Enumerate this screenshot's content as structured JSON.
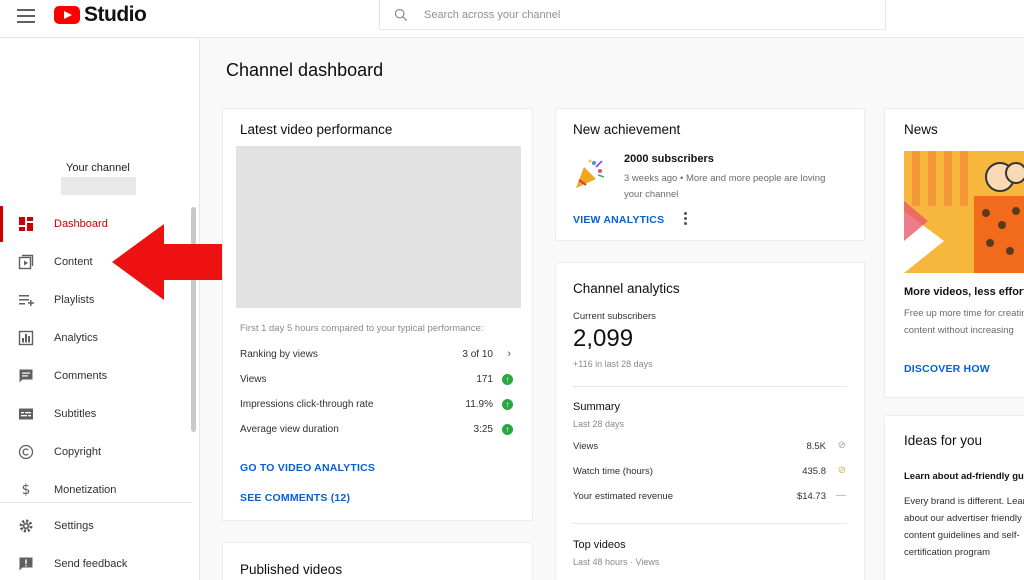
{
  "app": {
    "logo_text": "Studio"
  },
  "search": {
    "placeholder": "Search across your channel"
  },
  "sidebar": {
    "channel_label": "Your channel",
    "items": [
      {
        "label": "Dashboard",
        "icon": "dashboard-icon",
        "active": true
      },
      {
        "label": "Content",
        "icon": "content-icon"
      },
      {
        "label": "Playlists",
        "icon": "playlists-icon"
      },
      {
        "label": "Analytics",
        "icon": "analytics-icon"
      },
      {
        "label": "Comments",
        "icon": "comments-icon"
      },
      {
        "label": "Subtitles",
        "icon": "subtitles-icon"
      },
      {
        "label": "Copyright",
        "icon": "copyright-icon"
      },
      {
        "label": "Monetization",
        "icon": "monetization-icon"
      },
      {
        "label": "Settings",
        "icon": "settings-icon"
      },
      {
        "label": "Send feedback",
        "icon": "feedback-icon"
      }
    ]
  },
  "main": {
    "title": "Channel dashboard",
    "latest_video": {
      "title": "Latest video performance",
      "note": "First 1 day 5 hours compared to your typical performance:",
      "rows": [
        {
          "label": "Ranking by views",
          "value": "3 of 10"
        },
        {
          "label": "Views",
          "value": "171"
        },
        {
          "label": "Impressions click-through rate",
          "value": "11.9%"
        },
        {
          "label": "Average view duration",
          "value": "3:25"
        }
      ],
      "analytics_link": "GO TO VIDEO ANALYTICS",
      "comments_link": "SEE COMMENTS (12)"
    },
    "published": {
      "title": "Published videos"
    },
    "achievement": {
      "title": "New achievement",
      "headline": "2000 subscribers",
      "desc": "3 weeks ago • More and more people are loving your channel",
      "link": "VIEW ANALYTICS"
    },
    "analytics": {
      "title": "Channel analytics",
      "subs_label": "Current subscribers",
      "subs_value": "2,099",
      "subs_change": "+116 in last 28 days",
      "summary_title": "Summary",
      "summary_sub": "Last 28 days",
      "summary_rows": [
        {
          "label": "Views",
          "value": "8.5K"
        },
        {
          "label": "Watch time (hours)",
          "value": "435.8"
        },
        {
          "label": "Your estimated revenue",
          "value": "$14.73"
        }
      ],
      "top_videos_title": "Top videos",
      "top_videos_sub": "Last 48 hours · Views"
    },
    "news": {
      "title": "News",
      "headline": "More videos, less effort",
      "desc_line1": "Free up more time for creating",
      "desc_line2": "content without increasing",
      "link": "DISCOVER HOW"
    },
    "ideas": {
      "title": "Ideas for you",
      "sub": "Learn about ad-friendly guidelines",
      "line1": "Every brand is different. Learn",
      "line2": "about our advertiser friendly",
      "line3": "content guidelines and self-",
      "line4": "certification program"
    }
  },
  "colors": {
    "accent_red": "#cc0000",
    "link_blue": "#065fd4",
    "arrow_red": "#ee1111",
    "positive_green": "#2ba640"
  }
}
